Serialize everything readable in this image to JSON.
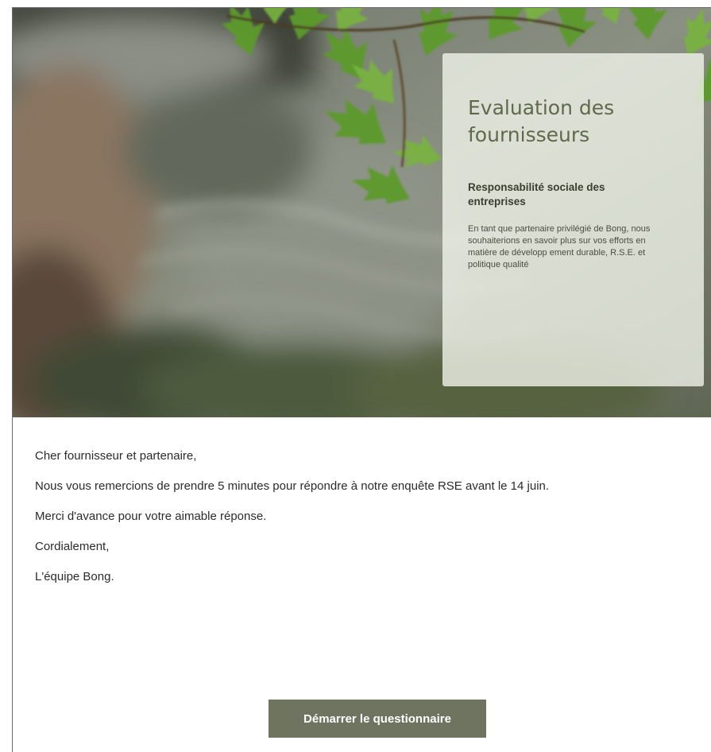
{
  "hero": {
    "title": "Evaluation des fournisseurs",
    "subtitle": "Responsabilité sociale des entreprises",
    "description": "En tant que partenaire privilégié de Bong, nous souhaiterions en savoir plus sur vos efforts en matière de développ ement durable, R.S.E. et politique qualité"
  },
  "message": {
    "greeting": "Cher fournisseur et partenaire,",
    "paragraph1": "Nous vous remercions de prendre 5 minutes pour répondre à notre enquête RSE avant le 14 juin.",
    "paragraph2": "Merci d'avance pour votre aimable réponse.",
    "closing": "Cordialement,",
    "signature": "L'équipe Bong."
  },
  "cta": {
    "label": "Démarrer le questionnaire"
  },
  "colors": {
    "button_bg": "#6e7460",
    "card_title": "#5f6a4c",
    "card_bg": "#f0f4ea"
  }
}
